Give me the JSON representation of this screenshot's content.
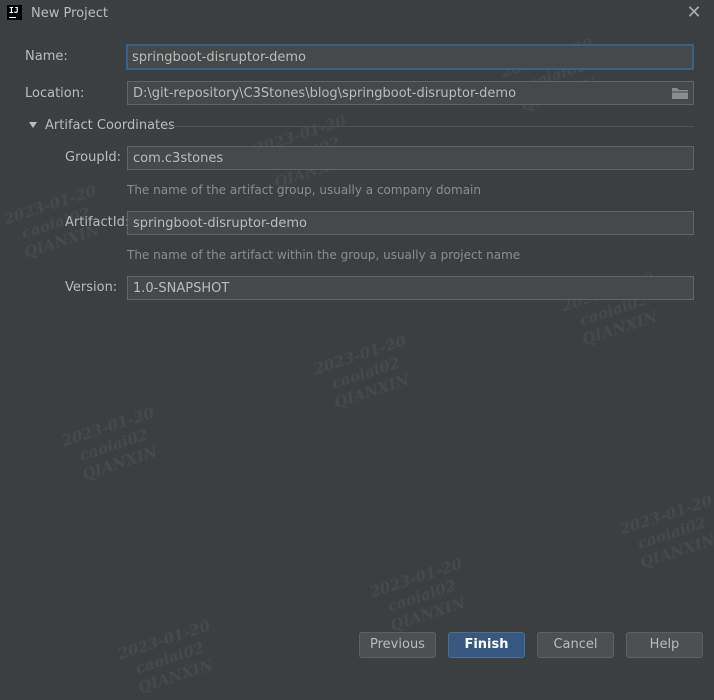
{
  "window": {
    "title": "New Project",
    "logo_text": "IJ"
  },
  "fields": {
    "name": {
      "label": "Name:",
      "value": "springboot-disruptor-demo"
    },
    "location": {
      "label": "Location:",
      "value": "D:\\git-repository\\C3Stones\\blog\\springboot-disruptor-demo"
    },
    "artifact_section": {
      "label": "Artifact Coordinates"
    },
    "group_id": {
      "label": "GroupId:",
      "value": "com.c3stones",
      "hint": "The name of the artifact group, usually a company domain"
    },
    "artifact_id": {
      "label": "ArtifactId:",
      "value": "springboot-disruptor-demo",
      "hint": "The name of the artifact within the group, usually a project name"
    },
    "version": {
      "label": "Version:",
      "value": "1.0-SNAPSHOT"
    }
  },
  "buttons": {
    "previous": "Previous",
    "finish": "Finish",
    "cancel": "Cancel",
    "help": "Help"
  },
  "watermark": {
    "line1": "2023-01-20",
    "line2": "caoiai02",
    "line3": "QIANXIN"
  },
  "colors": {
    "background": "#3c3f41",
    "field": "#45494a",
    "focus_border": "#3d6185",
    "primary_button": "#365880"
  },
  "icons": {
    "close": "close-icon",
    "folder": "folder-icon",
    "expand": "triangle-down-icon"
  }
}
